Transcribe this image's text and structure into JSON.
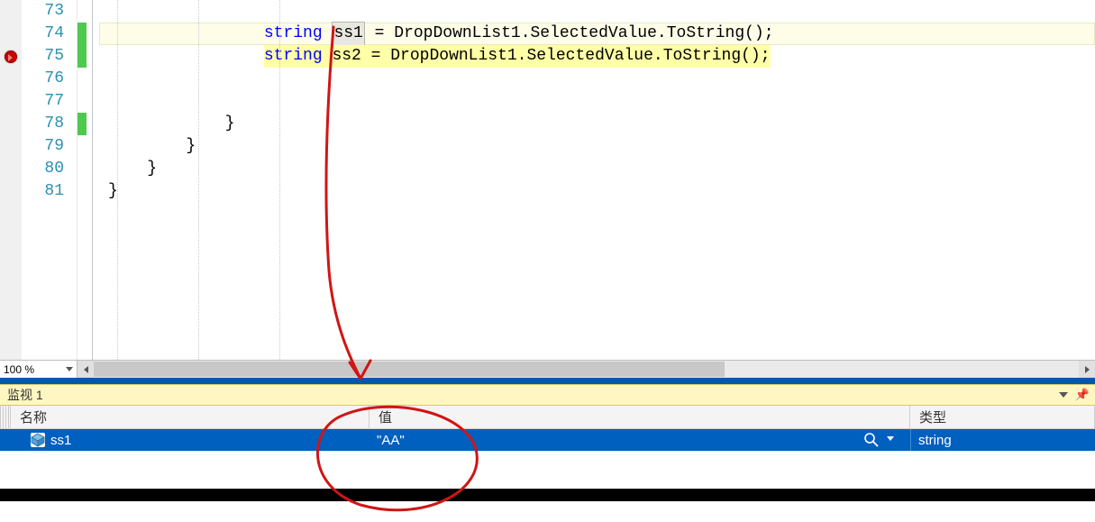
{
  "editor": {
    "lines": [
      {
        "n": 73,
        "pre": "",
        "text": ""
      },
      {
        "n": 74,
        "pre": "                ",
        "kw": "string",
        "rest1": " ",
        "boxed": "ss1",
        "rest2": " = DropDownList1.SelectedValue.ToString();",
        "current": true,
        "changed": true
      },
      {
        "n": 75,
        "pre": "                ",
        "kw": "string",
        "rest": " ss2 = DropDownList1.SelectedValue.ToString();",
        "exec": true,
        "bp": true,
        "changed": true
      },
      {
        "n": 76,
        "pre": "",
        "text": ""
      },
      {
        "n": 77,
        "pre": "",
        "text": ""
      },
      {
        "n": 78,
        "pre": "            ",
        "text": "}",
        "changed": true
      },
      {
        "n": 79,
        "pre": "        ",
        "text": "}"
      },
      {
        "n": 80,
        "pre": "    ",
        "text": "}"
      },
      {
        "n": 81,
        "pre": "",
        "text": "}"
      }
    ]
  },
  "zoom": {
    "level": "100 %"
  },
  "watch": {
    "title": "监视 1",
    "headers": {
      "name": "名称",
      "value": "值",
      "type": "类型"
    },
    "rows": [
      {
        "name": "ss1",
        "value": "\"AA\"",
        "type": "string"
      }
    ]
  }
}
